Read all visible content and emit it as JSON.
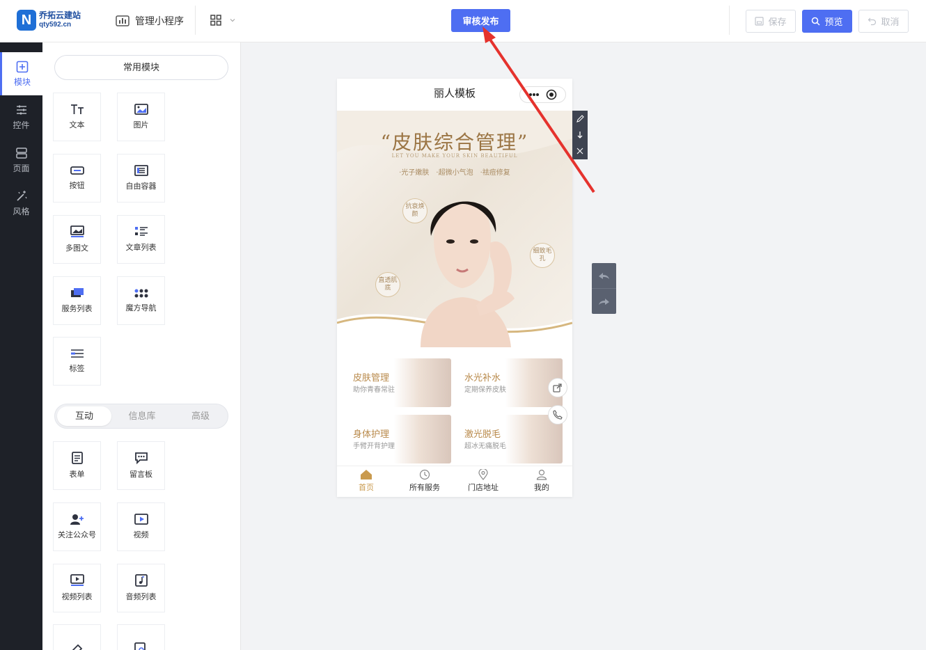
{
  "header": {
    "logo_mark": "N",
    "logo_name": "乔拓云建站",
    "logo_domain": "qty592.cn",
    "manage_label": "管理小程序",
    "publish_label": "审核发布",
    "save_label": "保存",
    "preview_label": "预览",
    "cancel_label": "取消"
  },
  "sidenav": {
    "items": [
      {
        "label": "模块",
        "icon": "plus-square-icon",
        "active": true
      },
      {
        "label": "控件",
        "icon": "sliders-icon"
      },
      {
        "label": "页面",
        "icon": "layers-icon"
      },
      {
        "label": "风格",
        "icon": "magic-wand-icon"
      }
    ]
  },
  "panel": {
    "common_title": "常用模块",
    "common_modules": [
      "文本",
      "图片",
      "按钮",
      "自由容器",
      "多图文",
      "文章列表",
      "服务列表",
      "魔方导航",
      "标签"
    ],
    "tabs": [
      "互动",
      "信息库",
      "高级"
    ],
    "interactive_modules": [
      "表单",
      "留言板",
      "关注公众号",
      "视频",
      "视频列表",
      "音频列表"
    ]
  },
  "phone": {
    "title": "丽人模板",
    "banner": {
      "title": "“皮肤综合管理”",
      "subtitle": "LET YOU MAKE YOUR SKIN BEAUTIFUL",
      "tags": "·光子嫩肤　·超微小气泡　·祛痘修复",
      "badges": [
        "抗衰焕颜",
        "细致毛孔",
        "直透肌底"
      ]
    },
    "cards": [
      {
        "title": "皮肤管理",
        "sub": "助你青春常驻"
      },
      {
        "title": "水光补水",
        "sub": "定期保养皮肤"
      },
      {
        "title": "身体护理",
        "sub": "手臂开背护理"
      },
      {
        "title": "激光脱毛",
        "sub": "超冰无痛脱毛"
      }
    ],
    "tabbar": [
      {
        "label": "首页",
        "icon": "home-icon",
        "active": true
      },
      {
        "label": "所有服务",
        "icon": "clock-icon"
      },
      {
        "label": "门店地址",
        "icon": "location-icon"
      },
      {
        "label": "我的",
        "icon": "user-icon"
      }
    ]
  },
  "colors": {
    "accent": "#4e6ef2",
    "gold": "#c99a4e",
    "dark_nav": "#1e2128",
    "arrow": "#e5322d"
  }
}
